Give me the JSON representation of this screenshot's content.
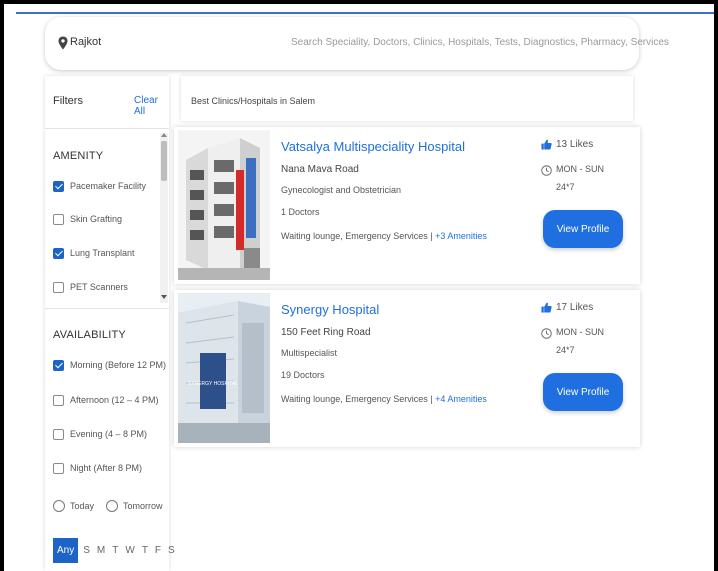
{
  "search": {
    "location": "Rajkot",
    "placeholder": "Search Speciality, Doctors, Clinics, Hospitals, Tests, Diagnostics, Pharmacy, Services"
  },
  "filters": {
    "title": "Filters",
    "clear_label": "Clear All",
    "amenity": {
      "title": "AMENITY",
      "items": [
        {
          "label": "Pacemaker Facility",
          "checked": true
        },
        {
          "label": "Skin Grafting",
          "checked": false
        },
        {
          "label": "Lung Transplant",
          "checked": true
        },
        {
          "label": "PET Scanners",
          "checked": false
        }
      ]
    },
    "availability": {
      "title": "AVAILABILITY",
      "items": [
        {
          "label": "Morning (Before 12 PM)",
          "checked": true
        },
        {
          "label": "Afternoon (12 – 4 PM)",
          "checked": false
        },
        {
          "label": "Evening (4 – 8 PM)",
          "checked": false
        },
        {
          "label": "Night (After 8 PM)",
          "checked": false
        }
      ],
      "radios": [
        "Today",
        "Tomorrow"
      ],
      "days": [
        "Any",
        "S",
        "M",
        "T",
        "W",
        "T",
        "F",
        "S"
      ],
      "selected_day": "Any"
    }
  },
  "breadcrumb": "Best Clinics/Hospitals  in Salem",
  "results": [
    {
      "name": "Vatsalya Multispeciality Hospital",
      "address": "Nana Mava Road",
      "speciality": "Gynecologist and Obstetrician",
      "doctors": "1 Doctors",
      "amenities": "Waiting lounge, Emergency Services |",
      "more_amenities": "+3 Amenities",
      "likes": "13 Likes",
      "days": "MON - SUN",
      "hours": "24*7",
      "button": "View Profile"
    },
    {
      "name": "Synergy Hospital",
      "address": "150 Feet Ring Road",
      "speciality": "Multispecialist",
      "doctors": "19 Doctors",
      "amenities": "Waiting lounge, Emergency Services |",
      "more_amenities": "+4 Amenities",
      "likes": "17 Likes",
      "days": "MON - SUN",
      "hours": "24*7",
      "button": "View Profile",
      "sign_text": "SYNERGY HOSPITAL"
    }
  ],
  "colors": {
    "accent": "#1f6fe0",
    "checkbox": "#1e63c6"
  }
}
